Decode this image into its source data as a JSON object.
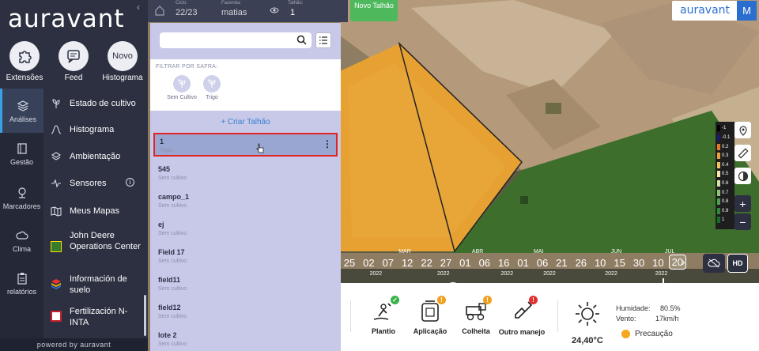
{
  "brand": {
    "logo": "auravant",
    "powered": "powered by auravant",
    "user_initial": "M"
  },
  "top_actions": [
    {
      "label": "Extensões",
      "icon": "puzzle-icon"
    },
    {
      "label": "Feed",
      "icon": "chat-icon"
    },
    {
      "label": "Histograma",
      "icon": "novo-icon",
      "badge": "Novo"
    }
  ],
  "rail": [
    {
      "label": "Análises",
      "icon": "layers-icon",
      "selected": true
    },
    {
      "label": "Gestão",
      "icon": "book-icon"
    },
    {
      "label": "Marcadores",
      "icon": "pin-icon"
    },
    {
      "label": "Clima",
      "icon": "cloud-icon"
    },
    {
      "label": "relatórios",
      "icon": "clipboard-icon"
    }
  ],
  "menu": [
    {
      "label": "Estado de cultivo",
      "icon": "plant-icon"
    },
    {
      "label": "Histograma",
      "icon": "bell-curve-icon"
    },
    {
      "label": "Ambientação",
      "icon": "layers-icon"
    },
    {
      "label": "Sensores",
      "icon": "pulse-icon"
    },
    {
      "label": "Meus Mapas",
      "icon": "map-icon"
    },
    {
      "label": "John Deere Operations Center",
      "icon": "john-deere-icon"
    },
    {
      "label": "Información de suelo",
      "icon": "soil-layers-icon"
    },
    {
      "label": "Fertilización N-INTA",
      "icon": "inta-icon"
    }
  ],
  "topbar": {
    "ciclo_label": "Ciclo:",
    "ciclo": "22/23",
    "fazenda_label": "Fazenda:",
    "fazenda": "matias",
    "talhao_label": "Talhão:",
    "talhao": "1",
    "novo_talhao": "Novo Talhão"
  },
  "panel": {
    "search_placeholder": "",
    "filter_label": "FILTRAR POR SAFRA:",
    "crops": [
      "Sem Cultivo",
      "Trigo"
    ],
    "create": "+ Criar Talhão",
    "fields": [
      {
        "name": "1",
        "crop": "Trigo",
        "selected": true
      },
      {
        "name": "545",
        "crop": "Sem cultivo"
      },
      {
        "name": "campo_1",
        "crop": "Sem cultivo"
      },
      {
        "name": "ej",
        "crop": "Sem cultivo"
      },
      {
        "name": "Field 17",
        "crop": "Sem cultivo"
      },
      {
        "name": "field11",
        "crop": "Sem cultivo"
      },
      {
        "name": "field12",
        "crop": "Sem cultivo"
      },
      {
        "name": "lote 2",
        "crop": "Sem cultivo"
      }
    ]
  },
  "timeline": {
    "days": [
      "25",
      "02",
      "07",
      "12",
      "22",
      "27",
      "01",
      "06",
      "16",
      "01",
      "06",
      "21",
      "26",
      "10",
      "15",
      "30",
      "10",
      "20"
    ],
    "months": [
      "MAR",
      "ABR",
      "MAI",
      "JUN",
      "JUL"
    ],
    "year": "2022",
    "selected": "20",
    "hd": "HD"
  },
  "legend": [
    {
      "v": "-1",
      "c": "#000000"
    },
    {
      "v": "-0.1",
      "c": "#1a1a6a"
    },
    {
      "v": "0.2",
      "c": "#e07a2a"
    },
    {
      "v": "0.3",
      "c": "#e9a03a"
    },
    {
      "v": "0.4",
      "c": "#efc25a"
    },
    {
      "v": "0.5",
      "c": "#f5e7a8"
    },
    {
      "v": "0.6",
      "c": "#cfe2a8"
    },
    {
      "v": "0.7",
      "c": "#8cc47a"
    },
    {
      "v": "0.8",
      "c": "#4fa04e"
    },
    {
      "v": "0.9",
      "c": "#2b8a3a"
    },
    {
      "v": "1",
      "c": "#176c2a"
    }
  ],
  "actions": [
    {
      "label": "Plantio",
      "icon": "planting-icon",
      "badge_color": "#3cb34a",
      "badge": "✓"
    },
    {
      "label": "Aplicação",
      "icon": "sprayer-icon",
      "badge_color": "#f0a020",
      "badge": "!"
    },
    {
      "label": "Colheita",
      "icon": "harvester-icon",
      "badge_color": "#f0a020",
      "badge": "!"
    },
    {
      "label": "Outro manejo",
      "icon": "shovel-icon",
      "badge_color": "#e03030",
      "badge": "!"
    }
  ],
  "weather": {
    "temp": "24,40°C",
    "humidity_label": "Humidade:",
    "humidity": "80.5%",
    "wind_label": "Vento:",
    "wind": "17km/h",
    "status": "Precaução"
  }
}
